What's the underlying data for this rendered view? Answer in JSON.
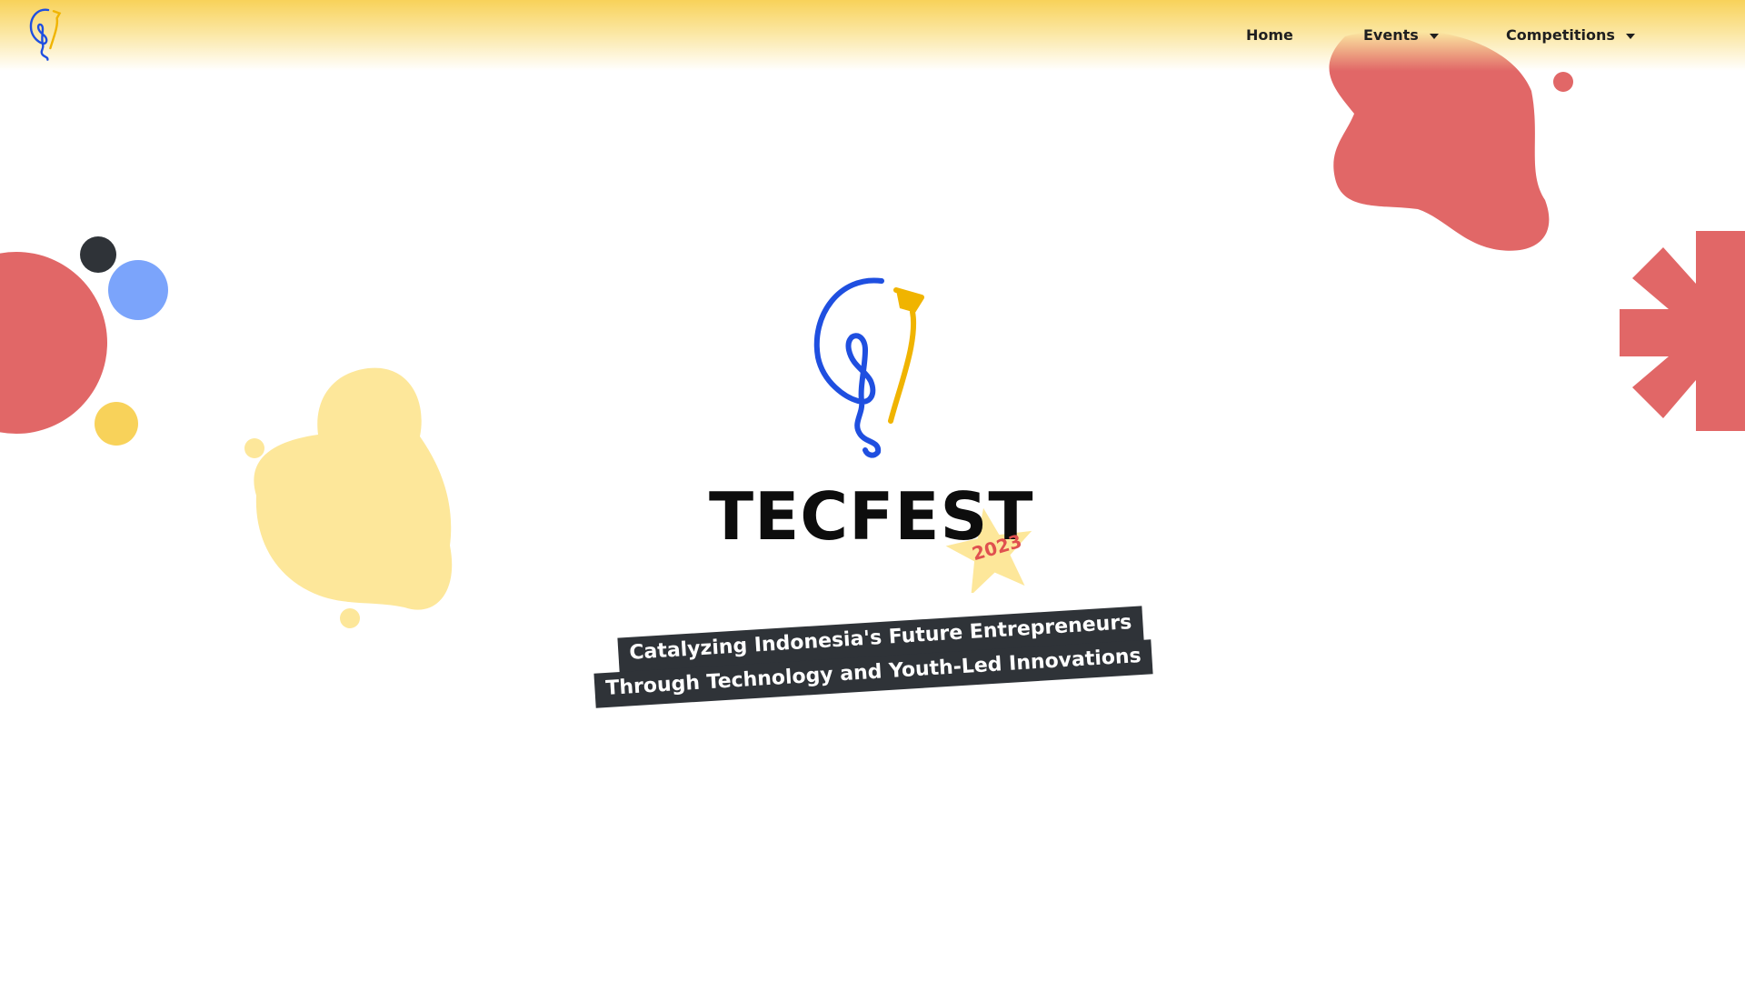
{
  "header": {
    "logo_name": "tecfest-bulb-logo"
  },
  "nav": {
    "items": [
      {
        "label": "Home",
        "has_dropdown": false
      },
      {
        "label": "Events",
        "has_dropdown": true
      },
      {
        "label": "Competitions",
        "has_dropdown": true
      }
    ]
  },
  "hero": {
    "title": "TECFEST",
    "year": "2023",
    "tagline_line1": "Catalyzing Indonesia's Future Entrepreneurs",
    "tagline_line2": "Through Technology and Youth-Led Innovations"
  },
  "colors": {
    "brand_yellow": "#f8d25a",
    "brand_red": "#e16767",
    "brand_blue": "#1f4fe0",
    "light_blue": "#7ba4fb",
    "dark": "#2f3338",
    "pale_yellow": "#fde79a"
  }
}
